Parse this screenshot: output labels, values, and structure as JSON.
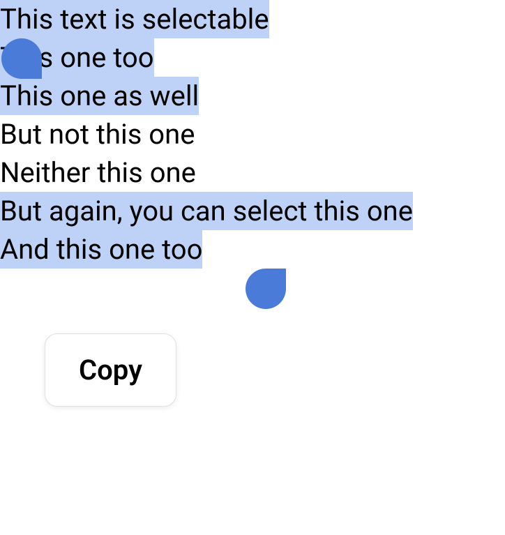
{
  "lines": [
    {
      "text": "This text is selectable",
      "highlighted": true
    },
    {
      "text": "This one too",
      "highlighted": true
    },
    {
      "text": "This one as well",
      "highlighted": true
    },
    {
      "text": "But not this one",
      "highlighted": false
    },
    {
      "text": "Neither this one",
      "highlighted": false
    },
    {
      "text": "But again, you can select this one",
      "highlighted": true
    },
    {
      "text": "And this one too",
      "highlighted": true
    }
  ],
  "menu": {
    "copy": "Copy"
  }
}
